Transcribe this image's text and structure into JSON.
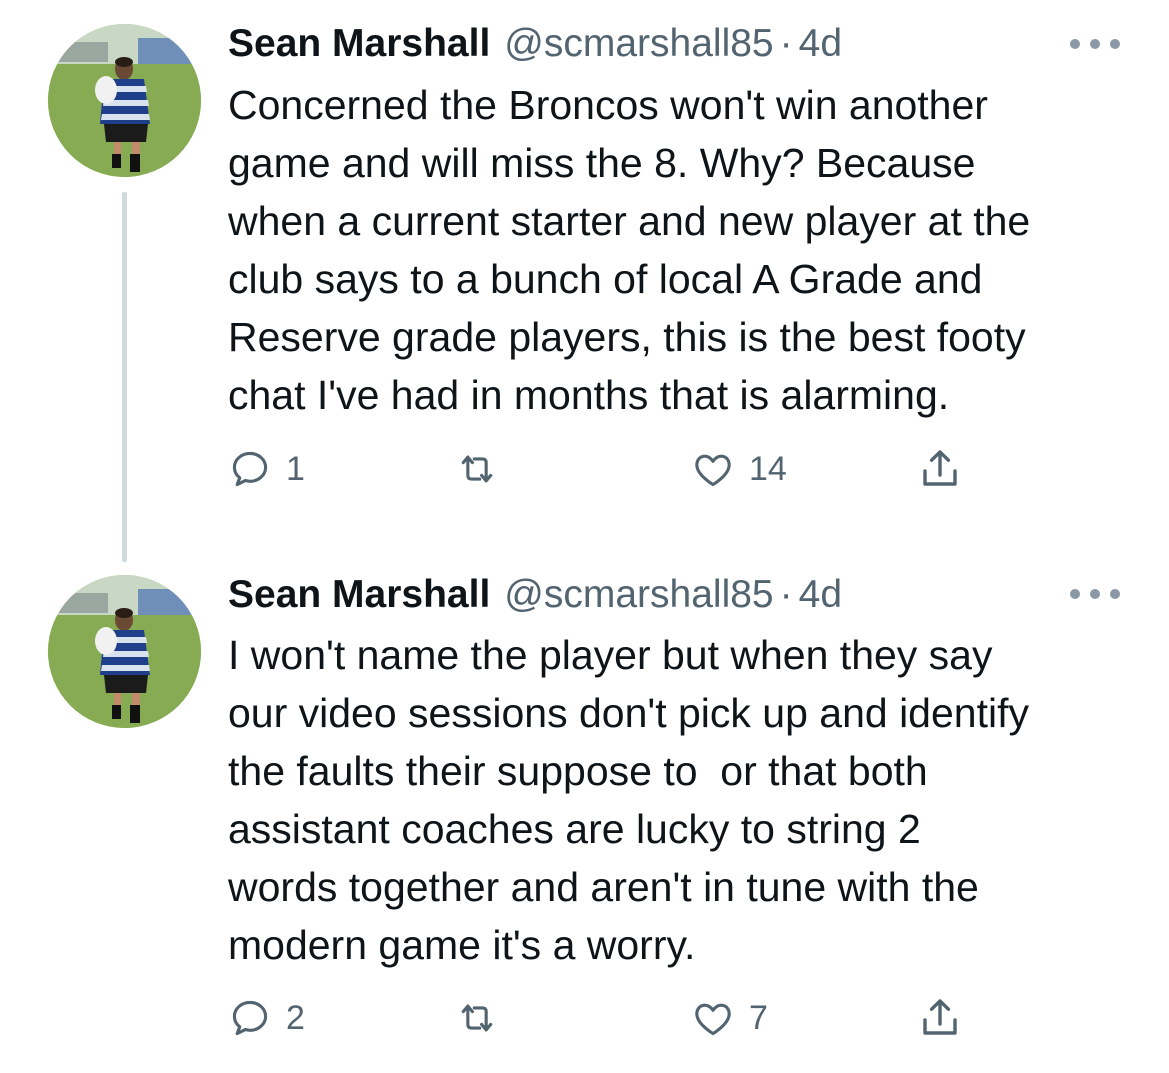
{
  "tweets": [
    {
      "author": {
        "name": "Sean Marshall",
        "handle": "@scmarshall85"
      },
      "separator": "·",
      "time": "4d",
      "text": "Concerned the Broncos won't win another\ngame and will miss the 8. Why? Because\nwhen a current starter and new player at the\nclub says to a bunch of local A Grade and\nReserve grade players, this is the best footy\nchat I've had in months that is alarming.",
      "replies": "1",
      "retweets": "",
      "likes": "14"
    },
    {
      "author": {
        "name": "Sean Marshall",
        "handle": "@scmarshall85"
      },
      "separator": "·",
      "time": "4d",
      "text": "I won't name the player but when they say\nour video sessions don't pick up and identify\nthe faults their suppose to  or that both\nassistant coaches are lucky to string 2\nwords together and aren't in tune with the\nmodern game it's a worry.",
      "replies": "2",
      "retweets": "",
      "likes": "7"
    }
  ],
  "icons": {
    "reply": "reply-icon",
    "retweet": "retweet-icon",
    "like": "heart-icon",
    "share": "share-icon",
    "more": "more-icon"
  },
  "colors": {
    "text_primary": "#0f1419",
    "text_secondary": "#536471",
    "thread_line": "#cfd9de",
    "avatar_jersey_blue": "#1f3f8a",
    "avatar_grass": "#7da24e"
  }
}
